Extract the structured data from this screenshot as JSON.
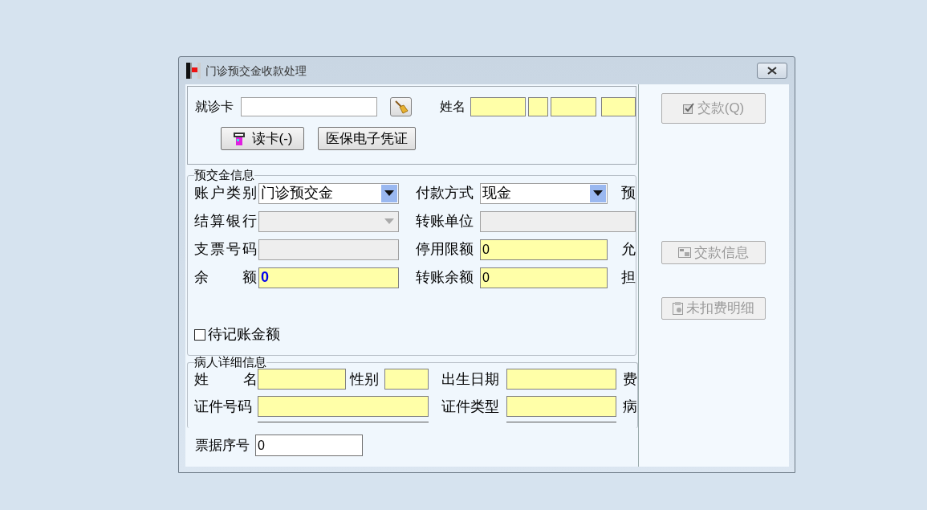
{
  "window": {
    "title": "门诊预交金收款处理"
  },
  "card": {
    "label": "就诊卡",
    "field": {
      "required": false
    },
    "name_label": "姓名"
  },
  "name_fields": [
    {
      "required": true
    },
    {
      "required": true
    },
    {
      "required": true
    },
    {
      "required": true
    }
  ],
  "card_buttons": [
    {
      "kind": "clear"
    },
    {
      "kind": "read",
      "label": "读卡(-)"
    },
    {
      "kind": "plain",
      "label": "医保电子凭证"
    }
  ],
  "deposit": {
    "legend": "预交金信息",
    "rows": [
      {
        "left": {
          "label": "账户类别",
          "kind": "combo",
          "value": "门诊预交金",
          "disabled": false,
          "required": false
        },
        "right": {
          "label": "付款方式",
          "kind": "combo",
          "value": "现金",
          "disabled": false,
          "required": false
        },
        "edge": "预"
      },
      {
        "left": {
          "label": "结算银行",
          "kind": "combo",
          "disabled": true,
          "required": false
        },
        "right": {
          "label": "转账单位",
          "kind": "text",
          "disabled": true,
          "required": false
        }
      },
      {
        "left": {
          "label": "支票号码",
          "kind": "text",
          "disabled": true,
          "required": false
        },
        "right": {
          "label": "停用限额",
          "kind": "text",
          "value": "0",
          "required": true
        },
        "edge": "允"
      },
      {
        "left": {
          "label": "余　额",
          "kind": "text",
          "value": "0",
          "required": true,
          "emphasis": true
        },
        "right": {
          "label": "转账余额",
          "kind": "text",
          "value": "0",
          "required": true
        },
        "edge": "担"
      }
    ],
    "pending": {
      "label": "待记账金额",
      "checked": false
    }
  },
  "patient": {
    "legend": "病人详细信息",
    "rows": [
      {
        "fields": [
          {
            "label": "姓　名",
            "required": true
          },
          {
            "label": "性别",
            "required": true
          },
          {
            "label": "出生日期",
            "required": true
          }
        ],
        "edge": "费"
      },
      {
        "fields": [
          {
            "label": "证件号码",
            "required": true
          },
          {
            "label": "证件类型",
            "required": true
          }
        ],
        "edge": "病"
      }
    ]
  },
  "receipt": {
    "label": "票据序号",
    "value": "0"
  },
  "actions": [
    {
      "label": "交款(Q)",
      "kind": "check",
      "disabled": true
    },
    {
      "label": "交款信息",
      "kind": "calculator",
      "disabled": true
    },
    {
      "label": "未扣费明细",
      "kind": "clipboard",
      "disabled": true
    }
  ]
}
